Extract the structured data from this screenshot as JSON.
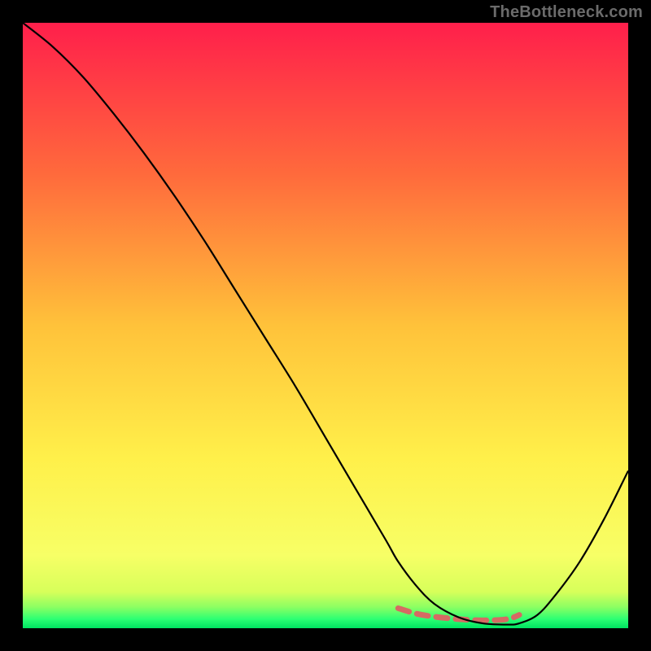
{
  "branding": {
    "watermark": "TheBottleneck.com"
  },
  "colors": {
    "black": "#000000",
    "gradient_stops": [
      {
        "offset": 0.0,
        "color": "#ff1f4b"
      },
      {
        "offset": 0.25,
        "color": "#ff6a3c"
      },
      {
        "offset": 0.5,
        "color": "#ffc23a"
      },
      {
        "offset": 0.72,
        "color": "#fff04a"
      },
      {
        "offset": 0.88,
        "color": "#f7ff66"
      },
      {
        "offset": 0.94,
        "color": "#d7ff5a"
      },
      {
        "offset": 0.965,
        "color": "#8cff62"
      },
      {
        "offset": 0.985,
        "color": "#2bff73"
      },
      {
        "offset": 1.0,
        "color": "#00e361"
      }
    ],
    "curve": "#000000",
    "highlight": "#d66a63"
  },
  "chart_data": {
    "type": "line",
    "title": "",
    "xlabel": "",
    "ylabel": "",
    "xlim": [
      0,
      100
    ],
    "ylim": [
      0,
      100
    ],
    "series": [
      {
        "name": "bottleneck-curve",
        "x": [
          0,
          5,
          10,
          15,
          20,
          25,
          30,
          35,
          40,
          45,
          50,
          55,
          60,
          62,
          65,
          68,
          72,
          76,
          80,
          82,
          85,
          88,
          92,
          96,
          100
        ],
        "y": [
          100,
          96,
          91,
          85,
          78.5,
          71.5,
          64,
          56,
          48,
          40,
          31.5,
          23,
          14.5,
          11,
          7,
          4,
          1.8,
          0.8,
          0.6,
          0.8,
          2.2,
          5.5,
          11,
          18,
          26
        ]
      },
      {
        "name": "optimal-band",
        "x": [
          62,
          65,
          68,
          72,
          76,
          80,
          82
        ],
        "y": [
          3.3,
          2.4,
          1.9,
          1.5,
          1.3,
          1.5,
          2.2
        ]
      }
    ],
    "optimal_range_x": [
      62,
      82
    ]
  }
}
